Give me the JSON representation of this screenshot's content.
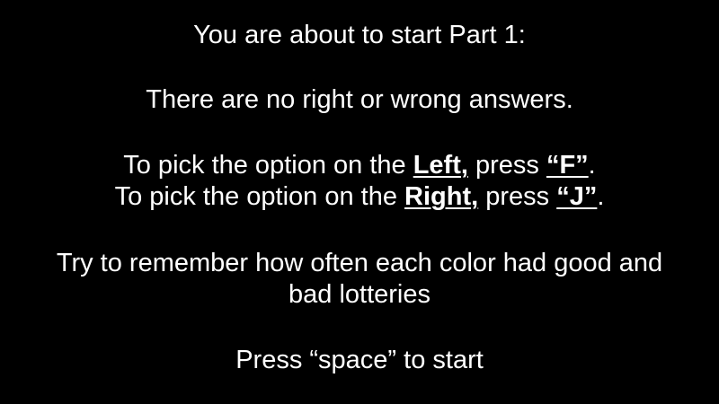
{
  "instructions": {
    "part_title": "You are about to start Part 1:",
    "no_right_wrong": "There are no right or wrong answers.",
    "left_line": {
      "prefix": "To pick the option on the ",
      "side": "Left,",
      "middle": " press ",
      "key": "“F”",
      "suffix": "."
    },
    "right_line": {
      "prefix": "To pick the option on the ",
      "side": "Right,",
      "middle": " press ",
      "key": "“J”",
      "suffix": "."
    },
    "remember_line1": "Try to remember how often each color had good and",
    "remember_line2": "bad lotteries",
    "start_prompt": "Press “space” to start"
  }
}
